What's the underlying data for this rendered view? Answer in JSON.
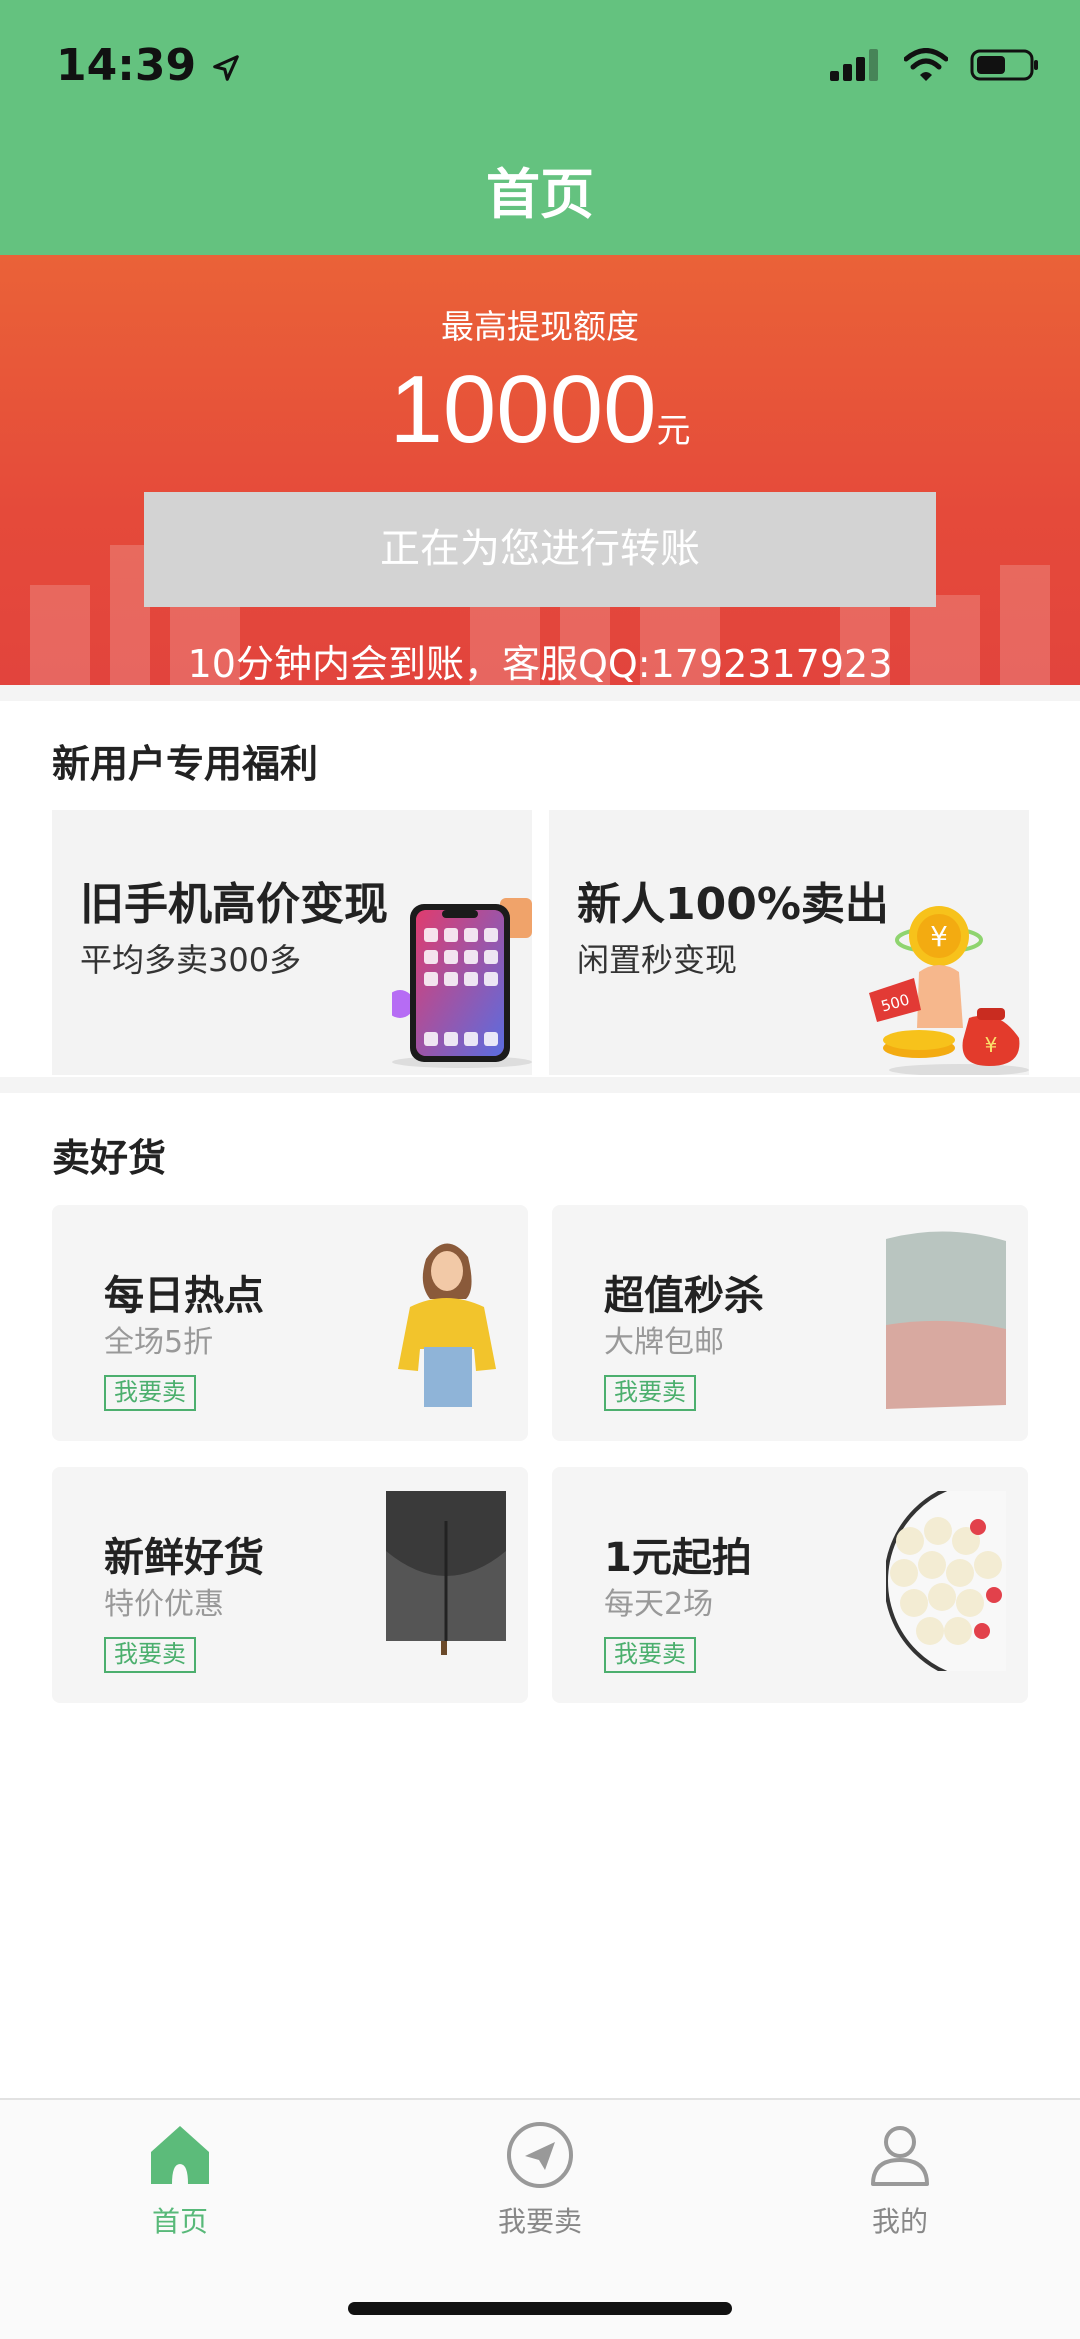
{
  "status_bar": {
    "time": "14:39"
  },
  "header": {
    "title": "首页"
  },
  "banner": {
    "label": "最高提现额度",
    "amount": "10000",
    "unit": "元",
    "button_label": "正在为您进行转账",
    "note": "10分钟内会到账，客服QQ:1792317923"
  },
  "welfare": {
    "title": "新用户专用福利",
    "cards": [
      {
        "title": "旧手机高价变现",
        "subtitle": "平均多卖300多"
      },
      {
        "title": "新人100%卖出",
        "subtitle": "闲置秒变现",
        "badge": "500"
      }
    ]
  },
  "goods": {
    "title": "卖好货",
    "cards": [
      {
        "title": "每日热点",
        "subtitle": "全场5折",
        "tag": "我要卖"
      },
      {
        "title": "超值秒杀",
        "subtitle": "大牌包邮",
        "tag": "我要卖"
      },
      {
        "title": "新鲜好货",
        "subtitle": "特价优惠",
        "tag": "我要卖"
      },
      {
        "title": "1元起拍",
        "subtitle": "每天2场",
        "tag": "我要卖"
      }
    ]
  },
  "tabbar": {
    "tabs": [
      {
        "label": "首页",
        "icon": "home-icon",
        "active": true
      },
      {
        "label": "我要卖",
        "icon": "send-icon",
        "active": false
      },
      {
        "label": "我的",
        "icon": "user-icon",
        "active": false
      }
    ]
  },
  "colors": {
    "header_green": "#64c27f",
    "banner_red": "#e54a3a",
    "accent_green": "#58b979"
  }
}
